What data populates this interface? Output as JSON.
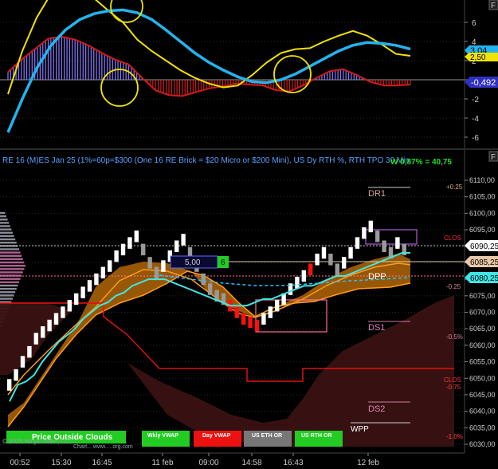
{
  "colors": {
    "background": "#000000",
    "grid": "#2a2a2a",
    "macd_fast": "#22b4ee",
    "macd_slow": "#f2e200",
    "hist_pos": "#8877ff",
    "hist_neg": "#d01a1a",
    "brick_up": "#ffffff",
    "brick_down": "#9a9a9a",
    "brick_red": "#ff1010",
    "cloud_fill": "#a45e05",
    "cloud_edge": "#ff9b1a",
    "cloud_dark": "#3a1212",
    "vwap": "#3fe6e6",
    "wvwap": "#2ac0ff",
    "red_line": "#e01010",
    "label_green": "#22cc22",
    "label_red": "#ee1111",
    "label_gray": "#777777"
  },
  "indicator_panel": {
    "y_ticks": [
      "6",
      "4",
      "2",
      "0",
      "-2",
      "-4",
      "-6"
    ],
    "value_fast": "3,04",
    "value_slow": "2,50",
    "value_hist": "-0,492",
    "corner_label": "F"
  },
  "price_panel": {
    "title": "RE 16 (M)ES Jan 25 (1%=60p=$300  (One 16 RE Brick = $20 Micro or $200 Mini), US Dy RTH %, RTH TPO 30 Min",
    "w_text": "W 0,87% = 40,75",
    "corner_label": "F",
    "y_ticks": [
      "6110,00",
      "6105,00",
      "6100,00",
      "6095,00",
      "6090,00",
      "6085,00",
      "6080,00",
      "6075,00",
      "6070,00",
      "6065,00",
      "6060,00",
      "6055,00",
      "6050,00",
      "6045,00",
      "6040,00",
      "6035,00",
      "6030,00"
    ],
    "right_labels": {
      "price_current": "6090,25",
      "price_mid": "6085,25",
      "price_low": "6080,25"
    },
    "level_labels": {
      "dr1": "DR1",
      "dpp": "DPP",
      "ds1": "DS1",
      "ds2": "DS2",
      "wpp": "WPP",
      "clos1": "CLOS",
      "clos2": "CLOS"
    },
    "pct_labels": {
      "p025": "+0.25",
      "m025": "-0.25",
      "m05": "-0.5%",
      "m075": "-0.75",
      "m10": "-1.0%"
    },
    "brick_info_value": "5,00",
    "brick_info_count": "6",
    "bottom_text": "Price Outside Clouds",
    "copyright": "© 2025 NinjaTrader, LLC",
    "attribution": "Chart... www.....org.com",
    "bottom_buttons": [
      "Wkly VWAP",
      "Day VWAP",
      "US ETH OR",
      "US RTH OR"
    ]
  },
  "x_axis": {
    "labels": [
      "00:52",
      "15:30",
      "16:45",
      "11 feb",
      "09:00",
      "14:58",
      "16:43",
      "12 feb"
    ]
  },
  "chart_data": [
    {
      "type": "line",
      "title": "",
      "ylim": [
        -7,
        8
      ],
      "series": [
        {
          "values": [
            -5.5,
            -2,
            1.2,
            3.6,
            5.2,
            6.3,
            6.9,
            7.2,
            7.3,
            7,
            6.3,
            5.2,
            4,
            2.8,
            1.8,
            1,
            0.3,
            -0.2,
            -0.3,
            0,
            0.6,
            1.4,
            2.2,
            3,
            3.6,
            3.9,
            3.8,
            3.6,
            3.2
          ]
        },
        {
          "values": [
            -1.5,
            3,
            6.5,
            9,
            9.5,
            9.2,
            8.5,
            7.2,
            6,
            4.2,
            3,
            2,
            1,
            0.2,
            -0.4,
            -0.8,
            -0.6,
            0.5,
            1.8,
            2.8,
            3.2,
            3.3,
            4,
            4.6,
            5.1,
            4.6,
            3.7,
            2.7,
            2.5
          ]
        },
        {
          "values": [
            0.8,
            2.1,
            3.2,
            4.3,
            4.5,
            4.2,
            3.6,
            2.8,
            2.1,
            1.6,
            0.2,
            -1.1,
            -1.6,
            -1.7,
            -1.3,
            -0.9,
            -0.7,
            -0.4,
            -0.5,
            -0.6,
            -1.1,
            -1.2,
            -0.6,
            0.2,
            0.9,
            1.1,
            0.5,
            -0.2,
            -0.6,
            -0.6,
            -0.5
          ]
        }
      ]
    },
    {
      "type": "bar",
      "title": "",
      "ylim": [
        6030,
        6110
      ],
      "series": [
        {
          "values": [
            6048,
            6051,
            6055,
            6058,
            6062,
            6064,
            6066,
            6068,
            6070,
            6072,
            6074,
            6076,
            6078,
            6080,
            6082,
            6084,
            6087,
            6089,
            6091,
            6093,
            6089,
            6085,
            6082,
            6084,
            6087,
            6090,
            6092,
            6088,
            6084,
            6080,
            6077,
            6075,
            6074,
            6072,
            6070,
            6068,
            6067,
            6066,
            6068,
            6070,
            6072,
            6074,
            6077,
            6079,
            6081,
            6083,
            6086,
            6088,
            6086,
            6083,
            6085,
            6088,
            6091,
            6094,
            6096,
            6093,
            6090,
            6088,
            6091,
            6089
          ]
        },
        {
          "values": [
            6043,
            6048,
            6049,
            6051,
            6055,
            6058,
            6061,
            6063,
            6065,
            6068,
            6070,
            6072,
            6073,
            6075,
            6076,
            6078,
            6079,
            6080,
            6080,
            6080,
            6079,
            6078,
            6077,
            6076,
            6075,
            6074,
            6073,
            6072,
            6072,
            6072,
            6073,
            6074,
            6074,
            6075,
            6076,
            6077,
            6078,
            6078,
            6079,
            6080,
            6081,
            6081,
            6082,
            6083,
            6084,
            6085,
            6086,
            6087,
            6088,
            6088
          ]
        }
      ]
    }
  ]
}
